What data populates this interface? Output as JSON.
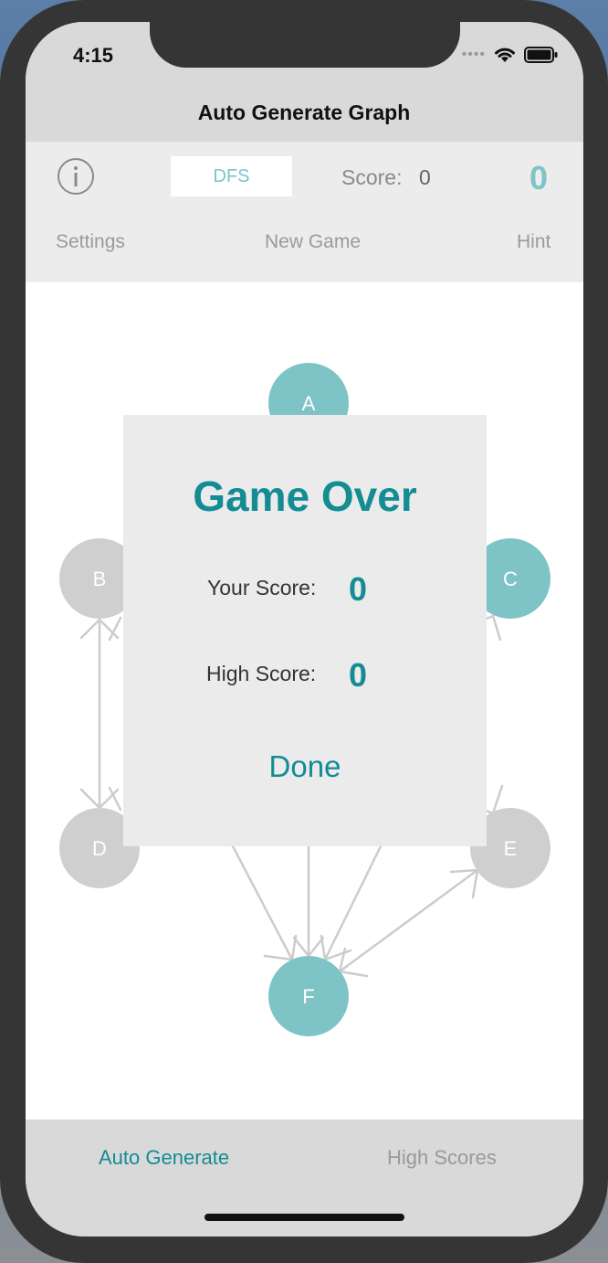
{
  "status_bar": {
    "time": "4:15"
  },
  "nav": {
    "title": "Auto Generate Graph"
  },
  "toolbar": {
    "algorithm": "DFS",
    "score_label": "Score:",
    "score_value": "0",
    "big_score": "0",
    "settings_label": "Settings",
    "new_game_label": "New Game",
    "hint_label": "Hint"
  },
  "graph": {
    "nodes": [
      {
        "id": "A",
        "label": "A",
        "state": "active"
      },
      {
        "id": "B",
        "label": "B",
        "state": "inactive"
      },
      {
        "id": "C",
        "label": "C",
        "state": "active"
      },
      {
        "id": "D",
        "label": "D",
        "state": "inactive"
      },
      {
        "id": "E",
        "label": "E",
        "state": "inactive"
      },
      {
        "id": "F",
        "label": "F",
        "state": "active"
      }
    ]
  },
  "modal": {
    "title": "Game Over",
    "your_score_label": "Your Score:",
    "your_score_value": "0",
    "high_score_label": "High Score:",
    "high_score_value": "0",
    "done_label": "Done"
  },
  "tabs": {
    "auto_generate": "Auto Generate",
    "high_scores": "High Scores"
  },
  "colors": {
    "accent": "#138c94",
    "node_active": "#7ec4c6",
    "node_inactive": "#cfcfcf",
    "edge": "#cccccc"
  }
}
